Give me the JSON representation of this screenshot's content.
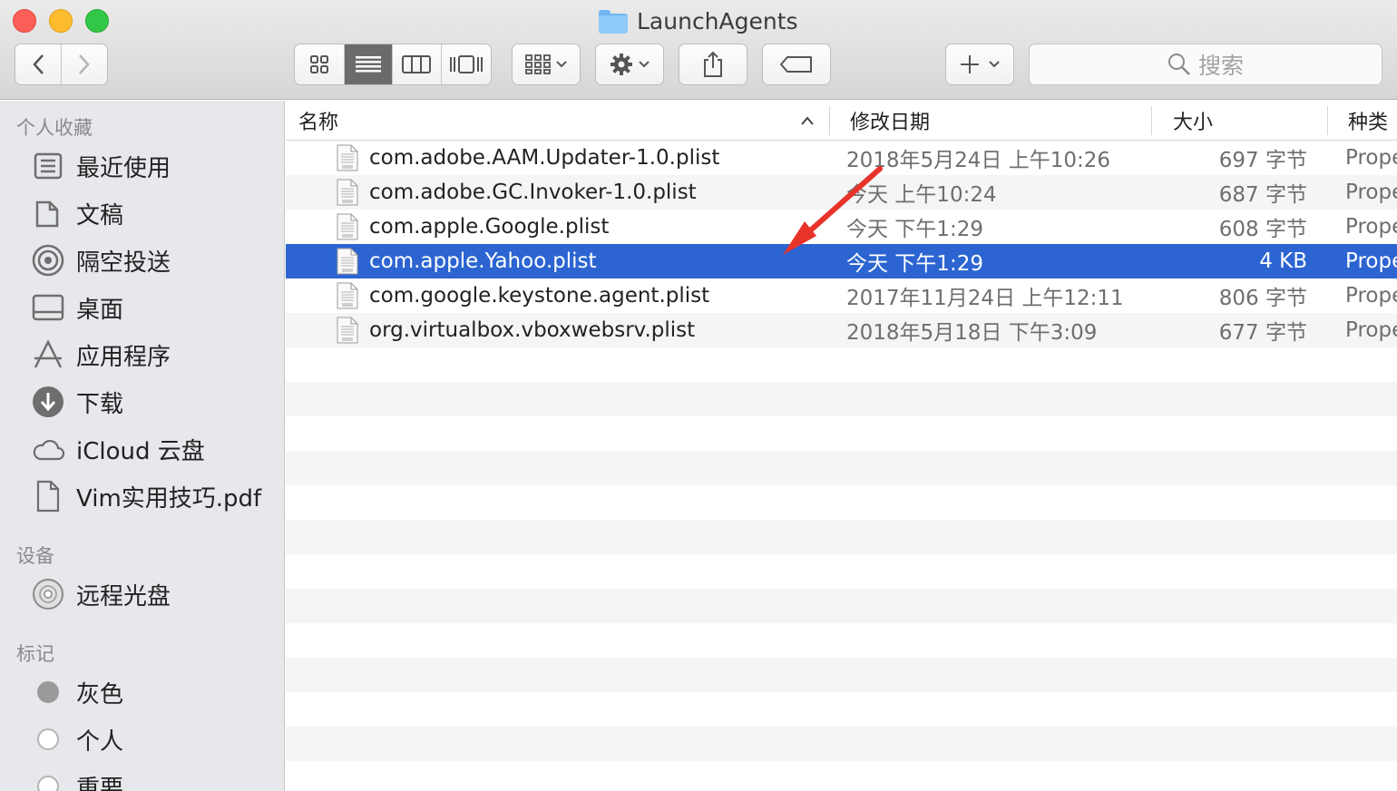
{
  "window": {
    "title": "LaunchAgents"
  },
  "toolbar": {
    "view_modes": [
      "icon-view",
      "list-view",
      "column-view",
      "cover-flow-view"
    ],
    "active_view": "list-view",
    "search_placeholder": "搜索"
  },
  "sidebar": {
    "favorites_title": "个人收藏",
    "favorites": [
      {
        "label": "最近使用",
        "icon": "recents-icon"
      },
      {
        "label": "文稿",
        "icon": "documents-icon"
      },
      {
        "label": "隔空投送",
        "icon": "airdrop-icon"
      },
      {
        "label": "桌面",
        "icon": "desktop-icon"
      },
      {
        "label": "应用程序",
        "icon": "applications-icon"
      },
      {
        "label": "下载",
        "icon": "downloads-icon"
      },
      {
        "label": "iCloud 云盘",
        "icon": "icloud-icon"
      },
      {
        "label": "Vim实用技巧.pdf",
        "icon": "document-file-icon"
      }
    ],
    "devices_title": "设备",
    "devices": [
      {
        "label": "远程光盘",
        "icon": "remote-disc-icon"
      }
    ],
    "tags_title": "标记",
    "tags": [
      {
        "label": "灰色",
        "color": "#9a9a9a"
      },
      {
        "label": "个人",
        "color": "#ffffff"
      },
      {
        "label": "重要",
        "color": "#ffffff"
      }
    ]
  },
  "columns": {
    "name": "名称",
    "date": "修改日期",
    "size": "大小",
    "kind": "种类"
  },
  "files": [
    {
      "name": "com.adobe.AAM.Updater-1.0.plist",
      "date": "2018年5月24日 上午10:26",
      "size": "697 字节",
      "kind": "Prope"
    },
    {
      "name": "com.adobe.GC.Invoker-1.0.plist",
      "date": "今天 上午10:24",
      "size": "687 字节",
      "kind": "Prope"
    },
    {
      "name": "com.apple.Google.plist",
      "date": "今天 下午1:29",
      "size": "608 字节",
      "kind": "Prope"
    },
    {
      "name": "com.apple.Yahoo.plist",
      "date": "今天 下午1:29",
      "size": "4 KB",
      "kind": "Prope",
      "selected": true
    },
    {
      "name": "com.google.keystone.agent.plist",
      "date": "2017年11月24日 上午12:11",
      "size": "806 字节",
      "kind": "Prope"
    },
    {
      "name": "org.virtualbox.vboxwebsrv.plist",
      "date": "2018年5月18日 下午3:09",
      "size": "677 字节",
      "kind": "Prope"
    }
  ],
  "colors": {
    "selection": "#2c65d2",
    "annotation_arrow": "#e8332a"
  }
}
